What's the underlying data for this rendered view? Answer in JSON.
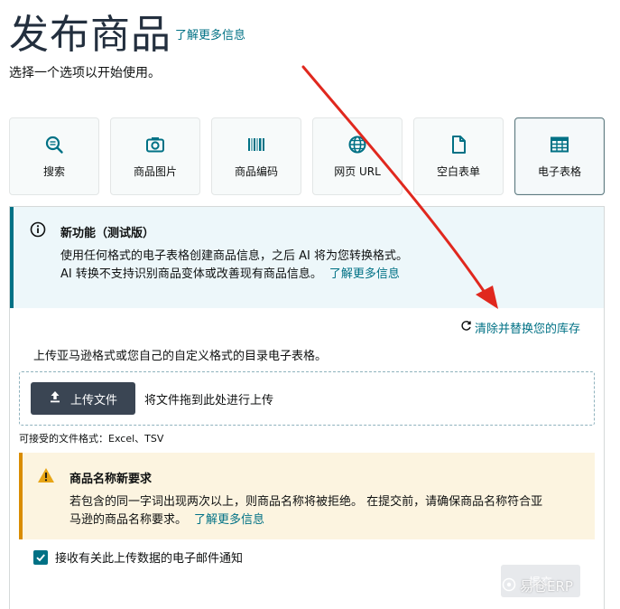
{
  "header": {
    "title": "发布商品",
    "learn_more": "了解更多信息",
    "subtitle": "选择一个选项以开始使用。"
  },
  "options": [
    {
      "label": "搜索",
      "icon": "search-icon"
    },
    {
      "label": "商品图片",
      "icon": "camera-icon"
    },
    {
      "label": "商品编码",
      "icon": "barcode-icon"
    },
    {
      "label": "网页 URL",
      "icon": "globe-icon"
    },
    {
      "label": "空白表单",
      "icon": "document-icon"
    },
    {
      "label": "电子表格",
      "icon": "spreadsheet-icon",
      "selected": true
    }
  ],
  "info_alert": {
    "title": "新功能（测试版）",
    "line1": "使用任何格式的电子表格创建商品信息，之后 AI 将为您转换格式。",
    "line2": "AI 转换不支持识别商品变体或改善现有商品信息。",
    "link": "了解更多信息"
  },
  "clear_replace": "清除并替换您的库存",
  "upload": {
    "description": "上传亚马逊格式或您自己的自定义格式的目录电子表格。",
    "button": "上传文件",
    "drop_text": "将文件拖到此处进行上传",
    "accepted_formats": "可接受的文件格式：Excel、TSV"
  },
  "warning_alert": {
    "title": "商品名称新要求",
    "line1": "若包含的同一字词出现两次以上，则商品名称将被拒绝。 在提交前，请确保商品名称符合亚",
    "line2": "马逊的商品名称要求。",
    "link": "了解更多信息"
  },
  "notify_checkbox": {
    "label": "接收有关此上传数据的电子邮件通知",
    "checked": true
  },
  "submit_button": "提交",
  "watermark": "易仓ERP",
  "colors": {
    "link": "#007185",
    "info_bg": "#edf7fa",
    "warning_bg": "#fcf4e0",
    "warning_accent": "#d98c00",
    "annotation_arrow": "#e0281e"
  }
}
